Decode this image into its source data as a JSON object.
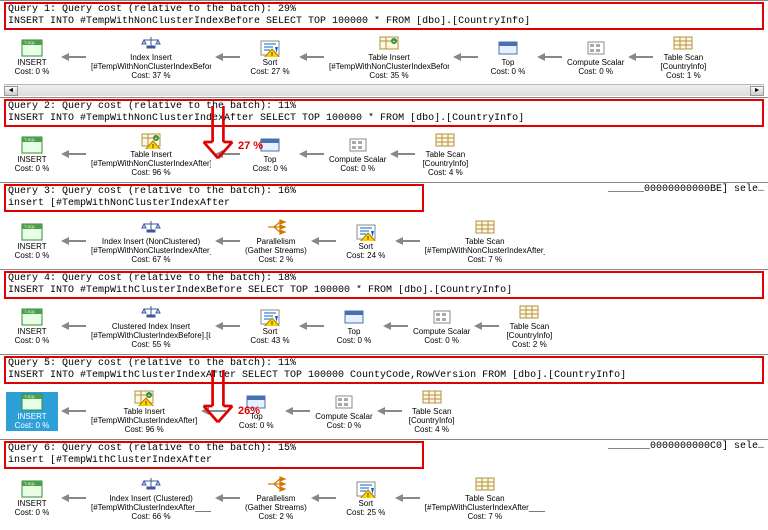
{
  "queries": [
    {
      "header1": "Query 1: Query cost (relative to the batch): 29%",
      "header2": "INSERT INTO #TempWithNonClusterIndexBefore SELECT TOP 100000 * FROM [dbo].[CountryInfo]",
      "boxed": true,
      "nodes": [
        {
          "label": "INSERT",
          "cost": "Cost: 0 %",
          "label2": "",
          "icon": "sql"
        },
        {
          "label": "Index Insert",
          "label2": "[#TempWithNonClusterIndexBefore].[ix…",
          "cost": "Cost: 37 %",
          "icon": "scale"
        },
        {
          "label": "Sort",
          "label2": "",
          "cost": "Cost: 27 %",
          "icon": "sort",
          "warn": true
        },
        {
          "label": "Table Insert",
          "label2": "[#TempWithNonClusterIndexBefore]",
          "cost": "Cost: 35 %",
          "icon": "tableinsert"
        },
        {
          "label": "Top",
          "label2": "",
          "cost": "Cost: 0 %",
          "icon": "top"
        },
        {
          "label": "Compute Scalar",
          "label2": "",
          "cost": "Cost: 0 %",
          "icon": "compute"
        },
        {
          "label": "Table Scan",
          "label2": "[CountryInfo]",
          "cost": "Cost: 1 %",
          "icon": "tablescan"
        }
      ],
      "scrollbar": true
    },
    {
      "header1": "Query 2: Query cost (relative to the batch): 11%",
      "header2": "INSERT INTO #TempWithNonClusterIndexAfter SELECT TOP 100000 * FROM [dbo].[CountryInfo]",
      "boxed": true,
      "nodes": [
        {
          "label": "INSERT",
          "label2": "",
          "cost": "Cost: 0 %",
          "icon": "sql"
        },
        {
          "label": "Table Insert",
          "label2": "[#TempWithNonClusterIndexAfter]",
          "cost": "Cost: 96 %",
          "icon": "tableinsert",
          "warn": true
        },
        {
          "label": "Top",
          "label2": "",
          "cost": "Cost: 0 %",
          "icon": "top"
        },
        {
          "label": "Compute Scalar",
          "label2": "",
          "cost": "Cost: 0 %",
          "icon": "compute"
        },
        {
          "label": "Table Scan",
          "label2": "[CountryInfo]",
          "cost": "Cost: 4 %",
          "icon": "tablescan"
        }
      ]
    },
    {
      "header1": "Query 3: Query cost (relative to the batch): 16%",
      "header2": "insert [#TempWithNonClusterIndexAfter_______________________________________________________________________________________00000000000BE] sele…",
      "boxed": true,
      "boxedShort": true,
      "nodes": [
        {
          "label": "INSERT",
          "label2": "",
          "cost": "Cost: 0 %",
          "icon": "sql"
        },
        {
          "label": "Index Insert (NonClustered)",
          "label2": "[#TempWithNonClusterIndexAfter____…",
          "cost": "Cost: 67 %",
          "icon": "scale"
        },
        {
          "label": "Parallelism",
          "label2": "(Gather Streams)",
          "cost": "Cost: 2 %",
          "icon": "parallel"
        },
        {
          "label": "Sort",
          "label2": "",
          "cost": "Cost: 24 %",
          "icon": "sort",
          "warn": true
        },
        {
          "label": "Table Scan",
          "label2": "[#TempWithNonClusterIndexAfter____…",
          "cost": "Cost: 7 %",
          "icon": "tablescan"
        }
      ]
    },
    {
      "header1": "Query 4: Query cost (relative to the batch): 18%",
      "header2": "INSERT INTO #TempWithClusterIndexBefore SELECT TOP 100000 * FROM [dbo].[CountryInfo]",
      "boxed": true,
      "nodes": [
        {
          "label": "INSERT",
          "label2": "",
          "cost": "Cost: 0 %",
          "icon": "sql"
        },
        {
          "label": "Clustered Index Insert",
          "label2": "[#TempWithClusterIndexBefore].[ix_t…",
          "cost": "Cost: 55 %",
          "icon": "scale"
        },
        {
          "label": "Sort",
          "label2": "",
          "cost": "Cost: 43 %",
          "icon": "sort",
          "warn": true
        },
        {
          "label": "Top",
          "label2": "",
          "cost": "Cost: 0 %",
          "icon": "top"
        },
        {
          "label": "Compute Scalar",
          "label2": "",
          "cost": "Cost: 0 %",
          "icon": "compute"
        },
        {
          "label": "Table Scan",
          "label2": "[CountryInfo]",
          "cost": "Cost: 2 %",
          "icon": "tablescan"
        }
      ]
    },
    {
      "header1": "Query 5: Query cost (relative to the batch): 11%",
      "header2": "INSERT INTO #TempWithClusterIndexAfter SELECT TOP 100000 CountyCode,RowVersion FROM [dbo].[CountryInfo]",
      "boxed": true,
      "nodes": [
        {
          "label": "INSERT",
          "label2": "",
          "cost": "Cost: 0 %",
          "icon": "sql",
          "highlight": true
        },
        {
          "label": "Table Insert",
          "label2": "[#TempWithClusterIndexAfter]",
          "cost": "Cost: 96 %",
          "icon": "tableinsert",
          "warn": true
        },
        {
          "label": "Top",
          "label2": "",
          "cost": "Cost: 0 %",
          "icon": "top"
        },
        {
          "label": "Compute Scalar",
          "label2": "",
          "cost": "Cost: 0 %",
          "icon": "compute"
        },
        {
          "label": "Table Scan",
          "label2": "[CountryInfo]",
          "cost": "Cost: 4 %",
          "icon": "tablescan"
        }
      ]
    },
    {
      "header1": "Query 6: Query cost (relative to the batch): 15%",
      "header2": "insert [#TempWithClusterIndexAfter_________________________________________________________________________________________0000000000C0] sele…",
      "boxed": true,
      "boxedShort": true,
      "nodes": [
        {
          "label": "INSERT",
          "label2": "",
          "cost": "Cost: 0 %",
          "icon": "sql"
        },
        {
          "label": "Index Insert (Clustered)",
          "label2": "[#TempWithClusterIndexAfter______…",
          "cost": "Cost: 66 %",
          "icon": "scale"
        },
        {
          "label": "Parallelism",
          "label2": "(Gather Streams)",
          "cost": "Cost: 2 %",
          "icon": "parallel"
        },
        {
          "label": "Sort",
          "label2": "",
          "cost": "Cost: 25 %",
          "icon": "sort",
          "warn": true
        },
        {
          "label": "Table Scan",
          "label2": "[#TempWithClusterIndexAfter______…",
          "cost": "Cost: 7 %",
          "icon": "tablescan"
        }
      ]
    }
  ],
  "annotations": {
    "arrow1_pct": "27 %",
    "arrow2_pct": "26%"
  }
}
